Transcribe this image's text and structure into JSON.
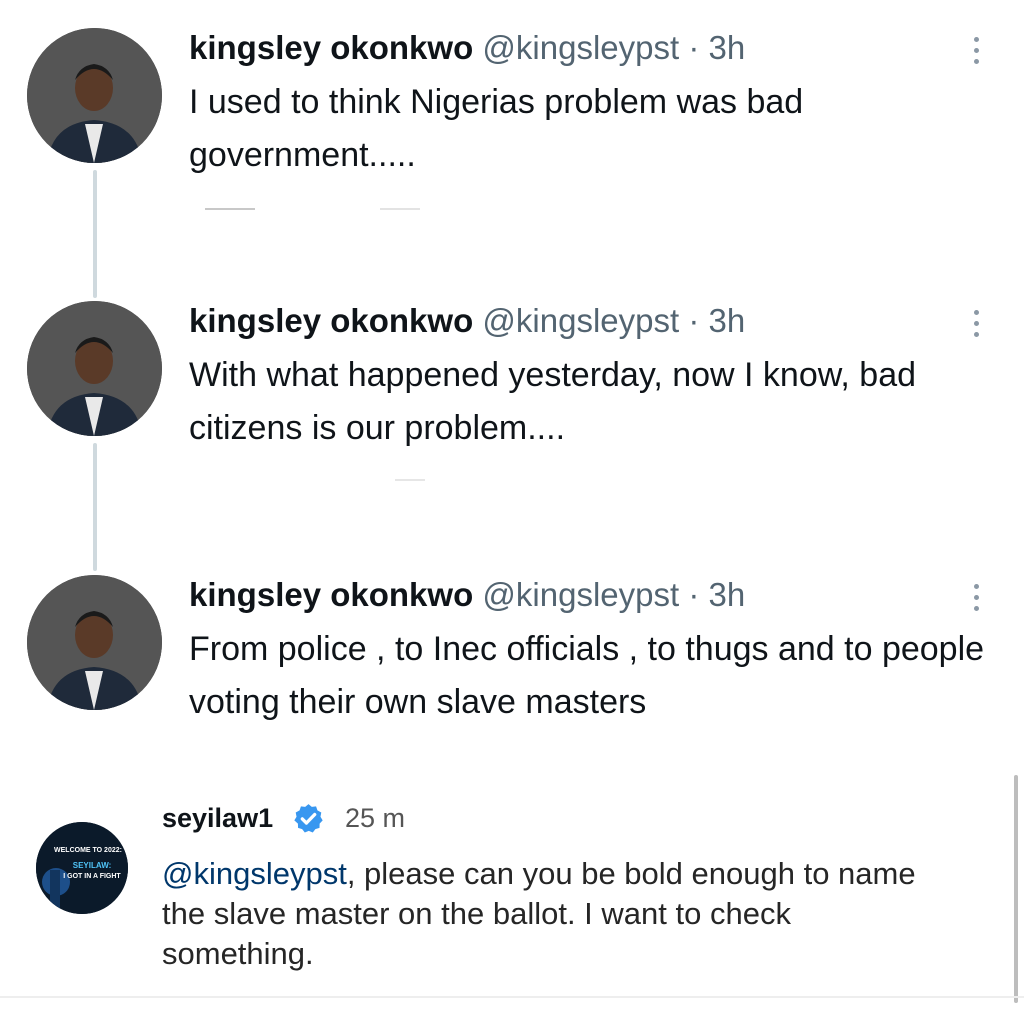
{
  "tweets": [
    {
      "name": "kingsley okonkwo",
      "handle": "@kingsleypst",
      "separator": "·",
      "time": "3h",
      "text": "I used to think Nigerias  problem was bad government....."
    },
    {
      "name": "kingsley okonkwo",
      "handle": "@kingsleypst",
      "separator": "·",
      "time": "3h",
      "text": "With what happened yesterday, now I know, bad citizens is our problem...."
    },
    {
      "name": "kingsley okonkwo",
      "handle": "@kingsleypst",
      "separator": "·",
      "time": "3h",
      "text": "From police , to Inec officials , to thugs and to people voting their own slave masters"
    }
  ],
  "comment": {
    "username": "seyilaw1",
    "time": "25 m",
    "mention": "@kingsleypst",
    "text": ", please can you be bold enough to name the slave master on the ballot. I want to check something.",
    "avatar_text_1": "WELCOME TO 2022:",
    "avatar_text_2": "SEYILAW:",
    "avatar_text_3": "I GOT IN A FIGHT"
  },
  "colors": {
    "name": "#0f1419",
    "secondary": "#536471",
    "thread_line": "#cfd9de",
    "verified": "#3897f0",
    "mention": "#00376b"
  },
  "icons": {
    "more": "more-vertical-icon",
    "verified": "verified-badge-icon"
  }
}
